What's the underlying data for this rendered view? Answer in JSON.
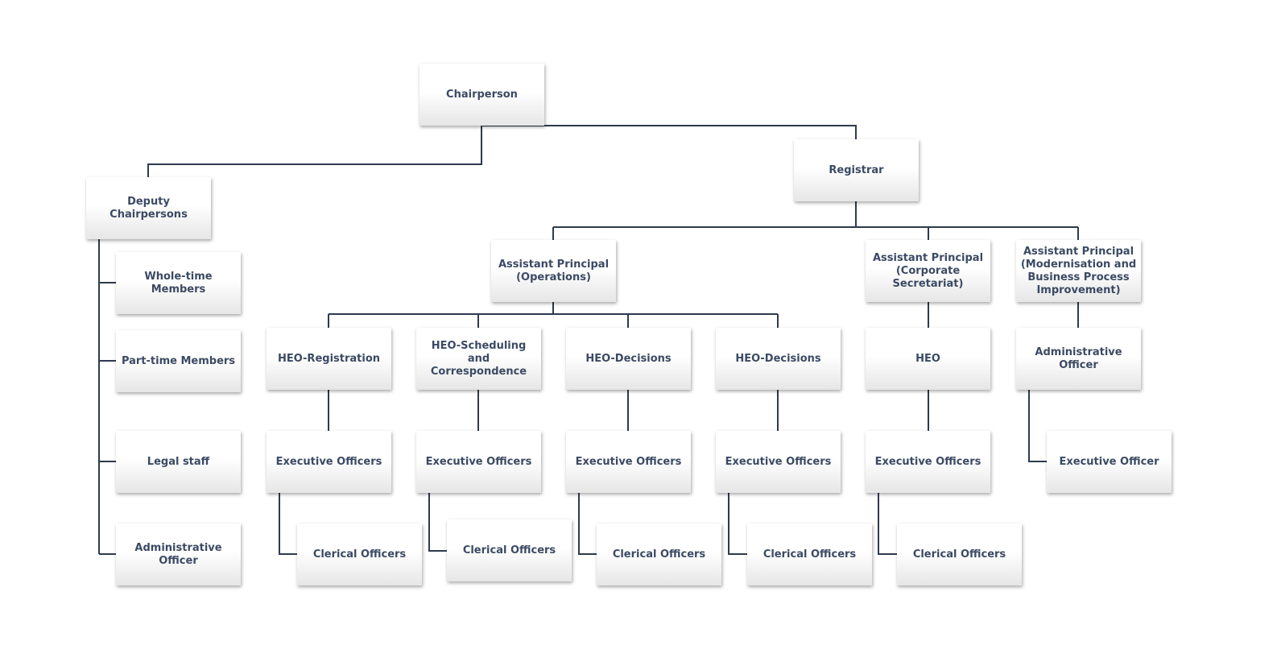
{
  "line_color": "#2e3a4e",
  "text_color": "#3b4a63",
  "nodes": {
    "chairperson": "Chairperson",
    "registrar": "Registrar",
    "deputy": "Deputy Chairpersons",
    "whole_time": "Whole-time Members",
    "part_time": "Part-time Members",
    "legal": "Legal staff",
    "deputy_admin": "Administrative Officer",
    "ap_ops": "Assistant Principal (Operations)",
    "ap_corp": "Assistant Principal (Corporate Secretariat)",
    "ap_mod": "Assistant Principal (Modernisation and Business Process Improvement)",
    "heo_reg": "HEO-Registration",
    "heo_sched": "HEO-Scheduling and Correspondence",
    "heo_dec1": "HEO-Decisions",
    "heo_dec2": "HEO-Decisions",
    "heo": "HEO",
    "mod_admin": "Administrative Officer",
    "exec1": "Executive Officers",
    "exec2": "Executive Officers",
    "exec3": "Executive Officers",
    "exec4": "Executive Officers",
    "exec5": "Executive Officers",
    "exec6": "Executive Officer",
    "cler1": "Clerical Officers",
    "cler2": "Clerical Officers",
    "cler3": "Clerical Officers",
    "cler4": "Clerical Officers",
    "cler5": "Clerical Officers"
  }
}
